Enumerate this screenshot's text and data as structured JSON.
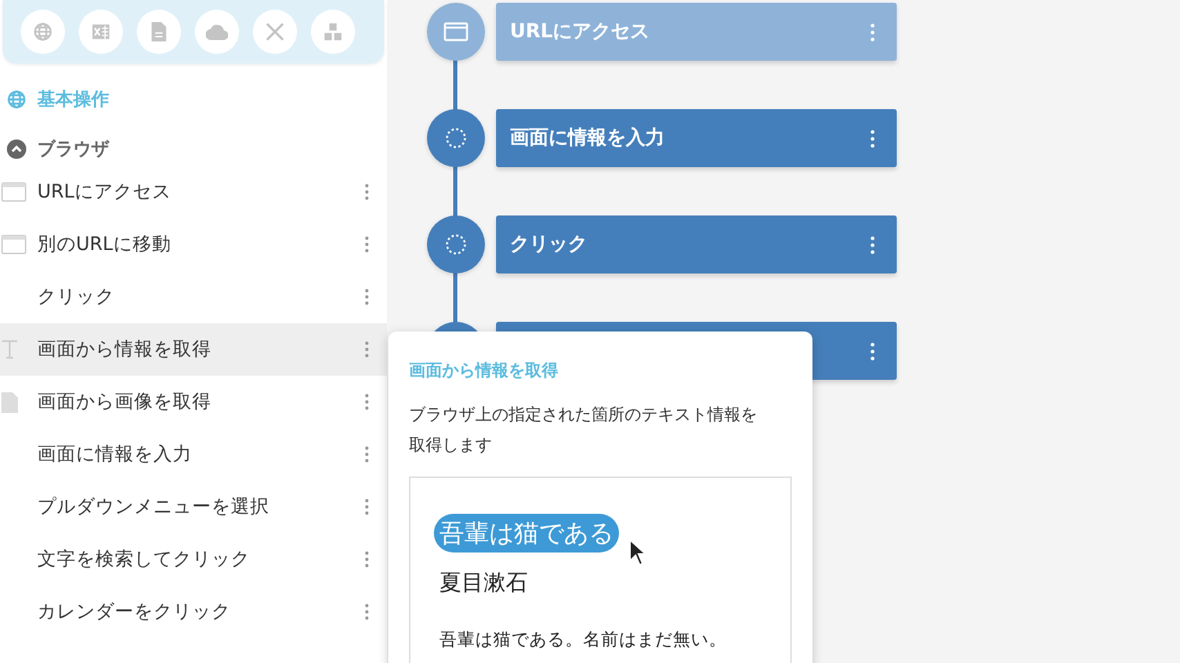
{
  "toolbar": {
    "buttons": [
      {
        "kind": "globe"
      },
      {
        "kind": "sheet"
      },
      {
        "kind": "document"
      },
      {
        "kind": "cloud"
      },
      {
        "kind": "tools"
      },
      {
        "kind": "blocks"
      }
    ]
  },
  "category": {
    "label": "基本操作"
  },
  "group": {
    "label": "ブラウザ",
    "expanded": true
  },
  "actions": [
    {
      "label": "URLにアクセス",
      "kind": "browser",
      "selected": false
    },
    {
      "label": "別のURLに移動",
      "kind": "browser",
      "selected": false
    },
    {
      "label": "クリック",
      "kind": "plain",
      "selected": false
    },
    {
      "label": "画面から情報を取得",
      "kind": "text",
      "selected": true
    },
    {
      "label": "画面から画像を取得",
      "kind": "file",
      "selected": false
    },
    {
      "label": "画面に情報を入力",
      "kind": "plain",
      "selected": false
    },
    {
      "label": "プルダウンメニューを選択",
      "kind": "plain",
      "selected": false
    },
    {
      "label": "文字を検索してクリック",
      "kind": "plain",
      "selected": false
    },
    {
      "label": "カレンダーをクリック",
      "kind": "plain",
      "selected": false
    }
  ],
  "flow": [
    {
      "label": "URLにアクセス",
      "kind": "browser",
      "dimmed": true
    },
    {
      "label": "画面に情報を入力",
      "kind": "pending",
      "dimmed": false
    },
    {
      "label": "クリック",
      "kind": "pending",
      "dimmed": false
    },
    {
      "dimmed": false
    }
  ],
  "popover": {
    "title": "画面から情報を取得",
    "description": "ブラウザ上の指定された箇所のテキスト情報を取得します",
    "preview": {
      "highlight": "吾輩は猫である",
      "author": "夏目漱石",
      "body": "吾輩は猫である。名前はまだ無い。"
    }
  }
}
